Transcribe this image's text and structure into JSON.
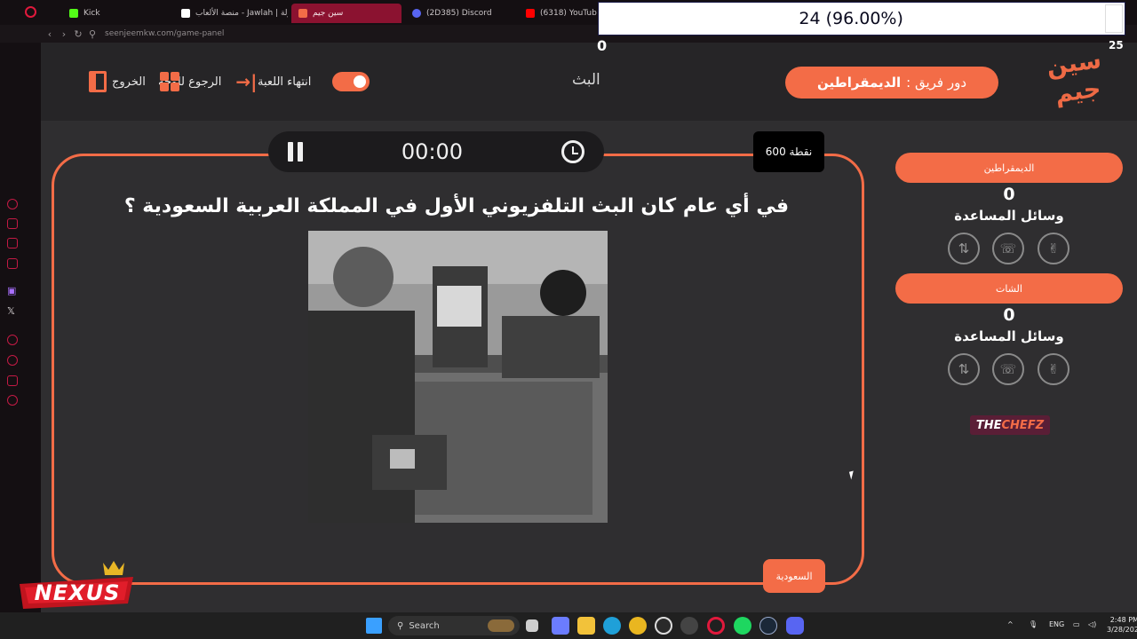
{
  "browser": {
    "tabs": [
      {
        "label": "Kick",
        "color": "#53fc18"
      },
      {
        "label": "جولة | Jawlah - منصة الألعاب",
        "color": "#ffffff"
      },
      {
        "label": "سين جيم",
        "color": "#f36c47"
      },
      {
        "label": "(2D385) Discord",
        "color": "#5865f2"
      },
      {
        "label": "(6318) YouTube",
        "color": "#ff0000"
      }
    ],
    "url": "seenjeemkw.com/game-panel"
  },
  "stream_overlay": {
    "goal_text": "24  (96.00%)",
    "goal_progress": 0.96,
    "goal_start": "0",
    "goal_end": "25"
  },
  "header": {
    "logo": {
      "line1": "سين",
      "line2": "جيم"
    },
    "turn_prefix": "دور فريق :",
    "turn_team": "الديمقراطين",
    "broadcast_label": "البث",
    "end_game_label": "انتهاء اللعبة",
    "back_to_board_label": "الرجوع للوحة",
    "exit_label": "الخروج"
  },
  "question_card": {
    "timer": "00:00",
    "points": "600 نقطة",
    "question": "في أي عام كان البث التلفزيوني الأول في المملكة العربية السعودية ؟",
    "answer_button": "السعودية"
  },
  "teams": [
    {
      "name": "الديمقراطين",
      "score": "0",
      "aids_label": "وسائل المساعدة"
    },
    {
      "name": "الشات",
      "score": "0",
      "aids_label": "وسائل المساعدة"
    }
  ],
  "sponsor": {
    "part1": "THE",
    "part2": "CHEFZ"
  },
  "watermark": "NEXUS",
  "taskbar": {
    "search_placeholder": "Search",
    "language": "ENG",
    "time": "2:48 PM",
    "date": "3/28/202"
  },
  "colors": {
    "accent": "#f36c47",
    "panel_bg": "#2f2e30",
    "header_bg": "#262527"
  }
}
